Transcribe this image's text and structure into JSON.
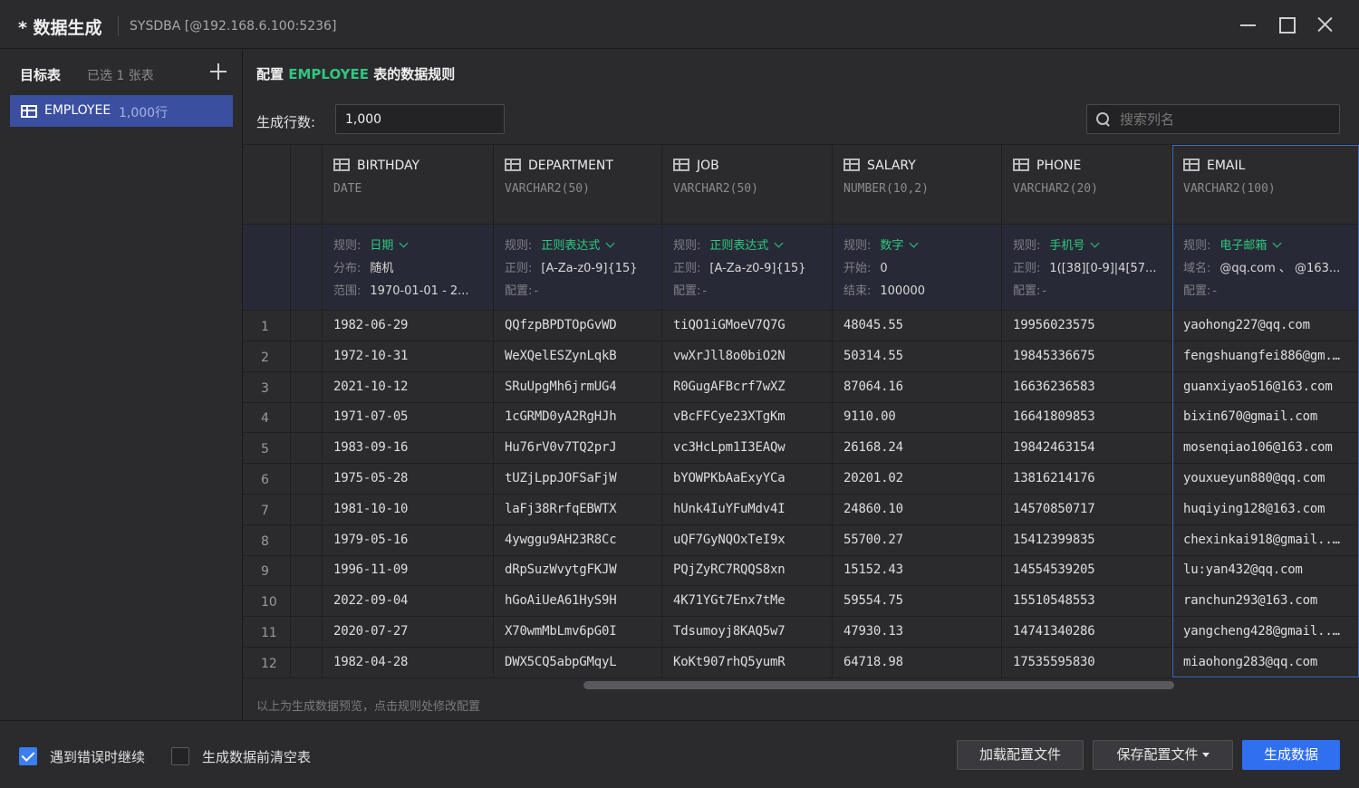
{
  "window": {
    "title": "* 数据生成",
    "connection": "SYSDBA [@192.168.6.100:5236]"
  },
  "left_panel": {
    "heading": "目标表",
    "selected_count": "已选 1 张表",
    "tables": [
      {
        "name": "EMPLOYEE",
        "rows": "1,000行"
      }
    ]
  },
  "config": {
    "title_prefix": "配置",
    "table": "EMPLOYEE",
    "title_suffix": "表的数据规则",
    "rows_label": "生成行数:",
    "rows_value": "1,000",
    "search_placeholder": "搜索列名"
  },
  "columns": [
    {
      "name": "BIRTHDAY",
      "type": "DATE",
      "rule": [
        {
          "key": "规则:",
          "value": "日期",
          "accent": true,
          "dropdown": true
        },
        {
          "key": "分布:",
          "value": "随机"
        },
        {
          "key": "范围:",
          "value": "1970-01-01 - 2..."
        }
      ]
    },
    {
      "name": "DEPARTMENT",
      "type": "VARCHAR2(50)",
      "rule": [
        {
          "key": "规则:",
          "value": "正则表达式",
          "accent": true,
          "dropdown": true
        },
        {
          "key": "正则:",
          "value": "[A-Za-z0-9]{15}"
        },
        {
          "key": "配置:",
          "value": "-",
          "dim": true
        }
      ]
    },
    {
      "name": "JOB",
      "type": "VARCHAR2(50)",
      "rule": [
        {
          "key": "规则:",
          "value": "正则表达式",
          "accent": true,
          "dropdown": true
        },
        {
          "key": "正则:",
          "value": "[A-Za-z0-9]{15}"
        },
        {
          "key": "配置:",
          "value": "-",
          "dim": true
        }
      ]
    },
    {
      "name": "SALARY",
      "type": "NUMBER(10,2)",
      "rule": [
        {
          "key": "规则:",
          "value": "数字",
          "accent": true,
          "dropdown": true
        },
        {
          "key": "开始:",
          "value": "0"
        },
        {
          "key": "结束:",
          "value": "100000"
        }
      ]
    },
    {
      "name": "PHONE",
      "type": "VARCHAR2(20)",
      "rule": [
        {
          "key": "规则:",
          "value": "手机号",
          "accent": true,
          "dropdown": true
        },
        {
          "key": "正则:",
          "value": "1([38][0-9]|4[57..."
        },
        {
          "key": "配置:",
          "value": "-",
          "dim": true
        }
      ]
    },
    {
      "name": "EMAIL",
      "type": "VARCHAR2(100)",
      "rule": [
        {
          "key": "规则:",
          "value": "电子邮箱",
          "accent": true,
          "dropdown": true
        },
        {
          "key": "域名:",
          "value": "@qq.com 、 @163..."
        },
        {
          "key": "配置:",
          "value": "-",
          "dim": true
        }
      ]
    }
  ],
  "rows": [
    [
      "1",
      "1982-06-29",
      "QQfzpBPDTOpGvWD",
      "tiQO1iGMoeV7Q7G",
      "48045.55",
      "19956023575",
      "yaohong227@qq.com"
    ],
    [
      "2",
      "1972-10-31",
      "WeXQelESZynLqkB",
      "vwXrJll8o0biO2N",
      "50314.55",
      "19845336675",
      "fengshuangfei886@gm..."
    ],
    [
      "3",
      "2021-10-12",
      "SRuUpgMh6jrmUG4",
      "R0GugAFBcrf7wXZ",
      "87064.16",
      "16636236583",
      "guanxiyao516@163.com"
    ],
    [
      "4",
      "1971-07-05",
      "1cGRMD0yA2RgHJh",
      "vBcFFCye23XTgKm",
      "9110.00",
      "16641809853",
      "bixin670@gmail.com"
    ],
    [
      "5",
      "1983-09-16",
      "Hu76rV0v7TQ2prJ",
      "vc3HcLpm1I3EAQw",
      "26168.24",
      "19842463154",
      "mosenqiao106@163.com"
    ],
    [
      "6",
      "1975-05-28",
      "tUZjLppJOFSaFjW",
      "bYOWPKbAaExyYCa",
      "20201.02",
      "13816214176",
      "youxueyun880@qq.com"
    ],
    [
      "7",
      "1981-10-10",
      "laFj38RrfqEBWTX",
      "hUnk4IuYFuMdv4I",
      "24860.10",
      "14570850717",
      "huqiying128@163.com"
    ],
    [
      "8",
      "1979-05-16",
      "4ywggu9AH23R8Cc",
      "uQF7GyNQOxTeI9x",
      "55700.27",
      "15412399835",
      "chexinkai918@gmail...."
    ],
    [
      "9",
      "1996-11-09",
      "dRpSuzWvytgFKJW",
      "PQjZyRC7RQQS8xn",
      "15152.43",
      "14554539205",
      "lu:yan432@qq.com"
    ],
    [
      "10",
      "2022-09-04",
      "hGoAiUeA61HyS9H",
      "4K71YGt7Enx7tMe",
      "59554.75",
      "15510548553",
      "ranchun293@163.com"
    ],
    [
      "11",
      "2020-07-27",
      "X70wmMbLmv6pG0I",
      "Tdsumoyj8KAQ5w7",
      "47930.13",
      "14741340286",
      "yangcheng428@gmail...."
    ],
    [
      "12",
      "1982-04-28",
      "DWX5CQ5abpGMqyL",
      "KoKt907rhQ5yumR",
      "64718.98",
      "17535595830",
      "miaohong283@qq.com"
    ]
  ],
  "hint": "以上为生成数据预览，点击规则处修改配置",
  "footer": {
    "continue_on_error": {
      "label": "遇到错误时继续",
      "checked": true
    },
    "truncate_before": {
      "label": "生成数据前清空表",
      "checked": false
    },
    "load_button": "加载配置文件",
    "save_button": "保存配置文件",
    "generate_button": "生成数据"
  },
  "colors": {
    "accent_green": "#2ec77f",
    "primary_blue": "#2f6ff0",
    "selected_item": "#3a4fa0"
  }
}
